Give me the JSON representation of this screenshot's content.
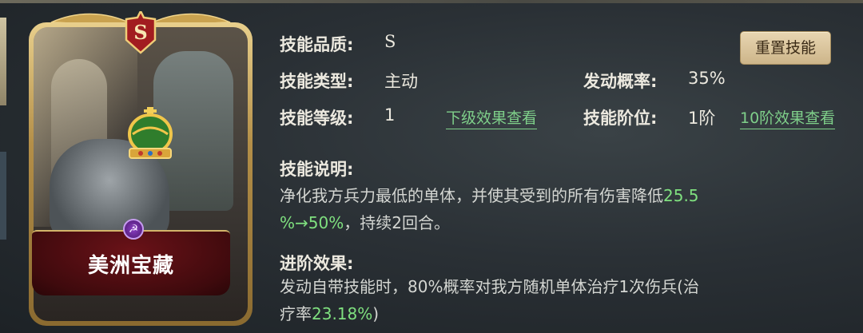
{
  "card": {
    "grade_letter": "S",
    "name": "美洲宝藏"
  },
  "skill": {
    "quality_label": "技能品质:",
    "quality_value": "S",
    "reset_button": "重置技能",
    "type_label": "技能类型:",
    "type_value": "主动",
    "trigger_label": "发动概率:",
    "trigger_value": "35%",
    "level_label": "技能等级:",
    "level_value": "1",
    "next_level_link": "下级效果查看",
    "rank_label": "技能阶位:",
    "rank_value": "1阶",
    "rank10_link": "10阶效果查看",
    "desc_label": "技能说明:",
    "desc_line1_text": "净化我方兵力最低的单体，并使其受到的所有伤害降低",
    "desc_line1_green": "25.5",
    "desc_line2_green": "%→50%",
    "desc_line2_text": "，持续2回合。",
    "advance_label": "进阶效果:",
    "advance_line1": "发动自带技能时，80%概率对我方随机单体治疗1次伤兵(治",
    "advance_line2_text": "疗率",
    "advance_line2_green": "23.18%",
    "advance_line2_end": ")"
  },
  "colors": {
    "highlight_green": "#7fe07f",
    "link_green": "#7fd08a",
    "button_gold": "#cdb58a",
    "banner_red": "#6a1218"
  }
}
